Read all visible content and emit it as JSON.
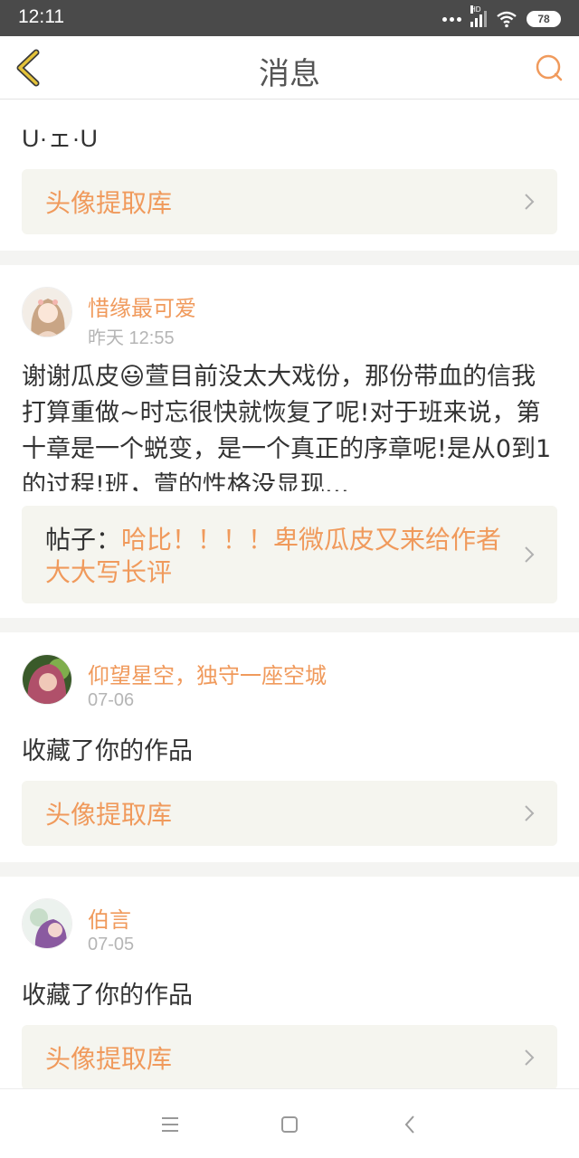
{
  "status_bar": {
    "time": "12:11",
    "hd": "HD",
    "battery": "78"
  },
  "nav": {
    "title": "消息"
  },
  "items": [
    {
      "message": "U·ェ·U",
      "ref_label": "头像提取库"
    },
    {
      "username": "惜缘最可爱",
      "time": "昨天 12:55",
      "message_part1": "谢谢瓜皮",
      "emoji": "😃",
      "message_part2": "萱目前没太大戏份，那份带血的信我打算重做~时忘很快就恢复了呢!对于班来说，第十章是一个蜕变，是一个真正的序章呢!是从0到1的过程!班，萱的性格没显现…",
      "ref_prefix": "帖子：",
      "ref_label": "哈比！！！！卑微瓜皮又来给作者大大写长评"
    },
    {
      "username": "仰望星空，独守一座空城",
      "time": "07-06",
      "message": "收藏了你的作品",
      "ref_label": "头像提取库"
    },
    {
      "username": "伯言",
      "time": "07-05",
      "message": "收藏了你的作品",
      "ref_label": "头像提取库"
    }
  ],
  "colors": {
    "accent": "#f09a5c",
    "ref_bg": "#f5f5ef",
    "status_bg": "#4a4a4a",
    "back_icon": "#e3c23a"
  }
}
